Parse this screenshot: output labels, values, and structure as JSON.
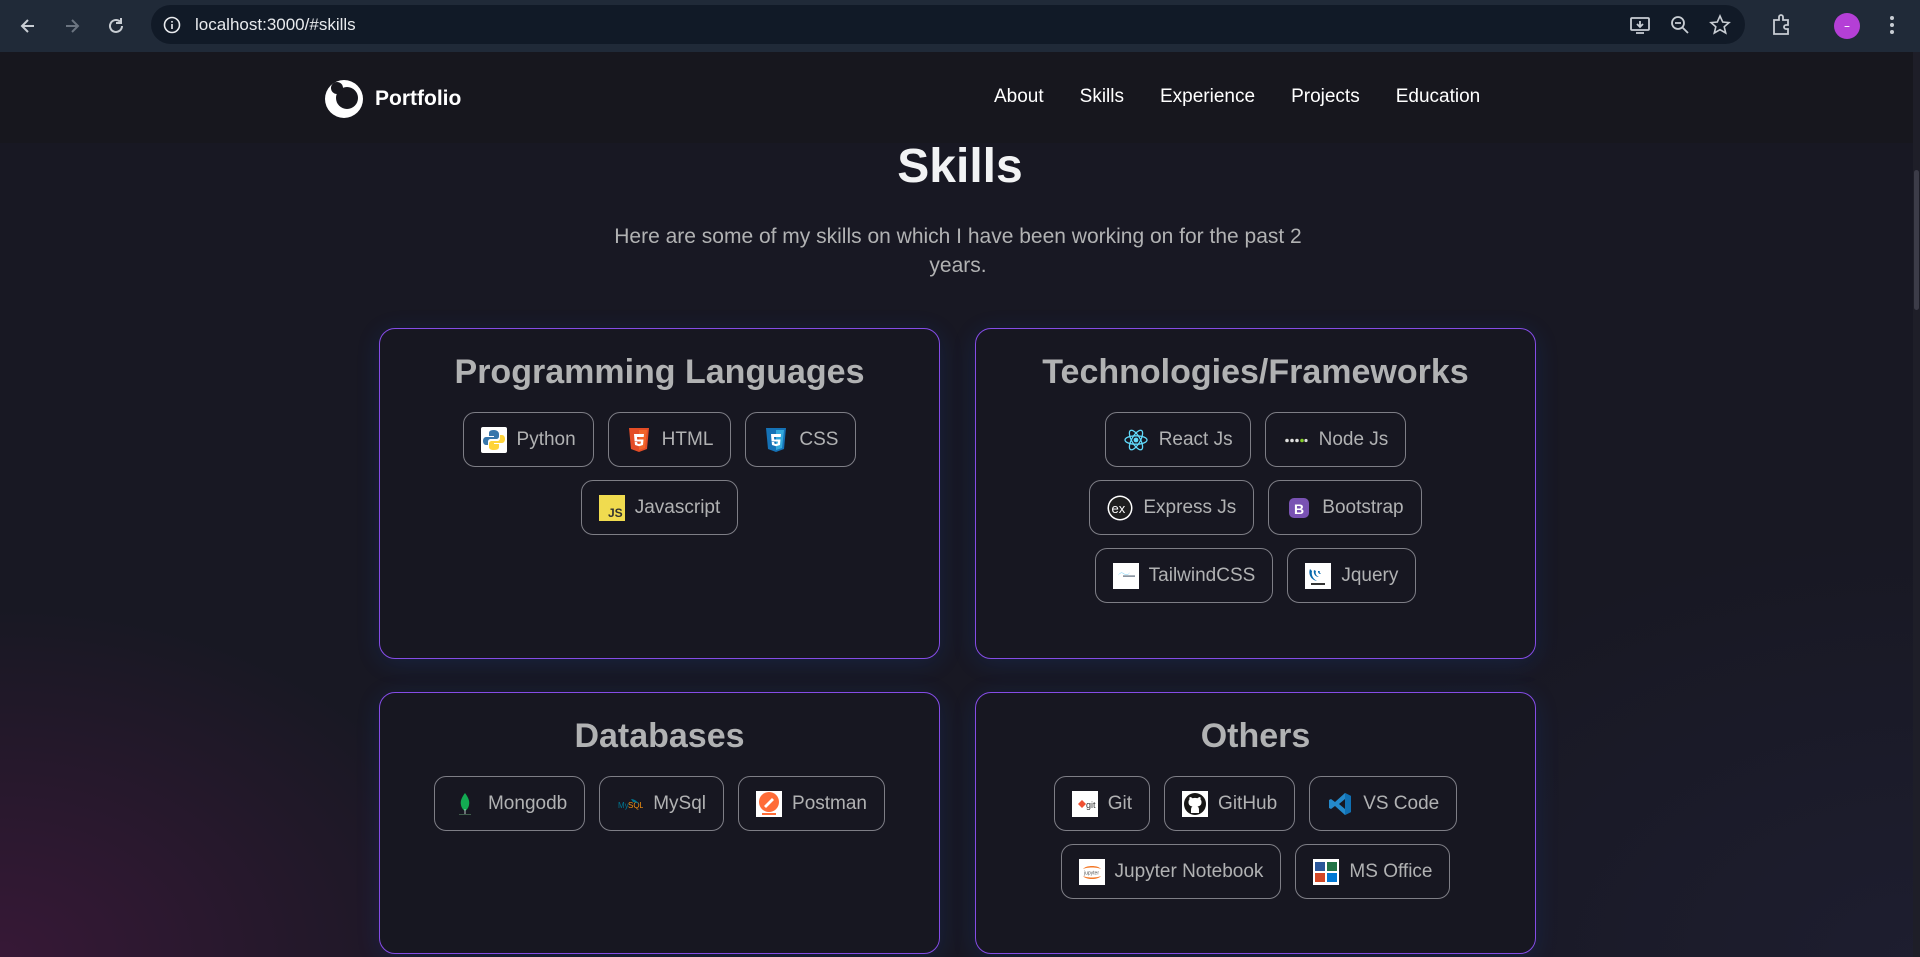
{
  "browser": {
    "url": "localhost:3000/#skills",
    "profile_initial": "–"
  },
  "site": {
    "logo_text": "Portfolio",
    "menu": [
      "About",
      "Skills",
      "Experience",
      "Projects",
      "Education"
    ]
  },
  "skills_section": {
    "title": "Skills",
    "subtitle": "Here are some of my skills on which I have been working on for the past 2 years."
  },
  "cards": [
    {
      "title": "Programming Languages",
      "skills": [
        {
          "name": "Python",
          "icon": "python-icon"
        },
        {
          "name": "HTML",
          "icon": "html5-icon"
        },
        {
          "name": "CSS",
          "icon": "css3-icon"
        },
        {
          "name": "Javascript",
          "icon": "javascript-icon"
        }
      ]
    },
    {
      "title": "Technologies/Frameworks",
      "skills": [
        {
          "name": "React Js",
          "icon": "react-icon"
        },
        {
          "name": "Node Js",
          "icon": "nodejs-icon"
        },
        {
          "name": "Express Js",
          "icon": "express-icon"
        },
        {
          "name": "Bootstrap",
          "icon": "bootstrap-icon"
        },
        {
          "name": "TailwindCSS",
          "icon": "tailwind-icon"
        },
        {
          "name": "Jquery",
          "icon": "jquery-icon"
        }
      ]
    },
    {
      "title": "Databases",
      "skills": [
        {
          "name": "Mongodb",
          "icon": "mongodb-icon"
        },
        {
          "name": "MySql",
          "icon": "mysql-icon"
        },
        {
          "name": "Postman",
          "icon": "postman-icon"
        }
      ]
    },
    {
      "title": "Others",
      "skills": [
        {
          "name": "Git",
          "icon": "git-icon"
        },
        {
          "name": "GitHub",
          "icon": "github-icon"
        },
        {
          "name": "VS Code",
          "icon": "vscode-icon"
        },
        {
          "name": "Jupyter Notebook",
          "icon": "jupyter-icon"
        },
        {
          "name": "MS Office",
          "icon": "ms-office-icon"
        }
      ]
    }
  ],
  "colors": {
    "background": "#181823",
    "card_border": "#854ce6",
    "text_secondary": "#b1b2b3",
    "nav_background": "#17171e"
  }
}
